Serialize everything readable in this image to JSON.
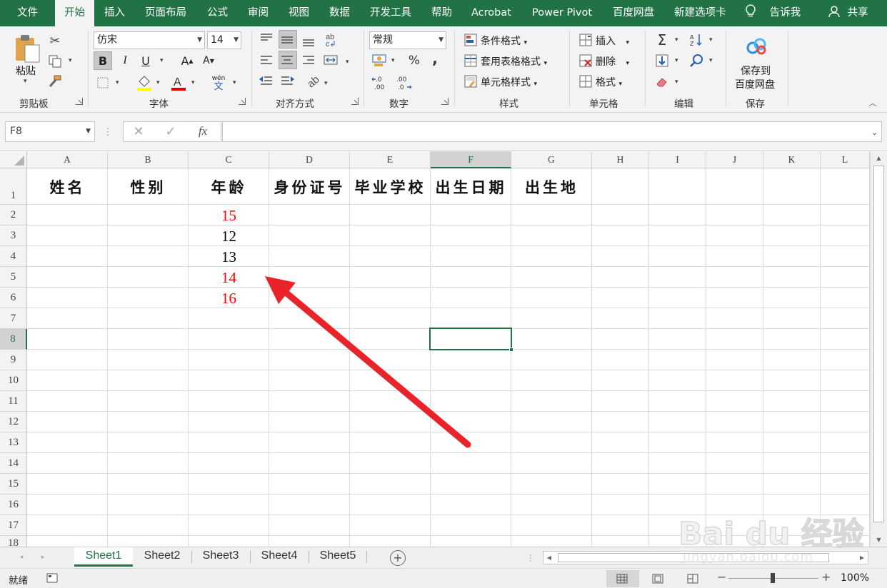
{
  "menu": {
    "tabs": [
      "文件",
      "开始",
      "插入",
      "页面布局",
      "公式",
      "审阅",
      "视图",
      "数据",
      "开发工具",
      "帮助",
      "Acrobat",
      "Power Pivot",
      "百度网盘",
      "新建选项卡"
    ],
    "active_tab": "开始",
    "tell_me": "告诉我",
    "share": "共享"
  },
  "ribbon": {
    "clipboard": {
      "paste": "粘贴",
      "label": "剪贴板"
    },
    "font": {
      "family": "仿宋",
      "size": "14",
      "bold": "B",
      "italic": "I",
      "underline": "U",
      "grow": "A",
      "shrink": "A",
      "phonetic_top": "wén",
      "phonetic_bottom": "文",
      "label": "字体"
    },
    "alignment": {
      "label": "对齐方式"
    },
    "number": {
      "format": "常规",
      "percent": "%",
      "comma": ",",
      "inc_decimal": "←.0 .00",
      "dec_decimal": ".00 →.0",
      "label": "数字"
    },
    "styles": {
      "conditional": "条件格式",
      "table": "套用表格格式",
      "cell": "单元格样式",
      "label": "样式"
    },
    "cells": {
      "insert": "插入",
      "delete": "删除",
      "format": "格式",
      "label": "单元格"
    },
    "editing": {
      "label": "编辑"
    },
    "save": {
      "line1": "保存到",
      "line2": "百度网盘",
      "label": "保存"
    }
  },
  "formula_bar": {
    "name_box": "F8",
    "fx": "fx",
    "formula": ""
  },
  "columns": [
    "A",
    "B",
    "C",
    "D",
    "E",
    "F",
    "G",
    "H",
    "I",
    "J",
    "K",
    "L"
  ],
  "rows": [
    "1",
    "2",
    "3",
    "4",
    "5",
    "6",
    "7",
    "8",
    "9",
    "10",
    "11",
    "12",
    "13",
    "14",
    "15",
    "16",
    "17",
    "18"
  ],
  "header_cells": [
    "姓名",
    "性别",
    "年龄",
    "身份证号",
    "毕业学校",
    "出生日期",
    "出生地"
  ],
  "age_values": [
    {
      "value": "15",
      "color": "#ff0000"
    },
    {
      "value": "12",
      "color": "#000000"
    },
    {
      "value": "13",
      "color": "#000000"
    },
    {
      "value": "14",
      "color": "#ff0000"
    },
    {
      "value": "16",
      "color": "#ff0000"
    }
  ],
  "selected_cell": "F8",
  "sheets": [
    "Sheet1",
    "Sheet2",
    "Sheet3",
    "Sheet4",
    "Sheet5"
  ],
  "active_sheet": "Sheet1",
  "status": {
    "ready": "就绪",
    "zoom": "100%"
  },
  "watermark": {
    "brand": "Bai du 经验",
    "url": "jingyan.baidu.com"
  },
  "colors": {
    "excel_green": "#217346",
    "annotation_arrow": "#e8232a",
    "highlight_red": "#ff0000"
  }
}
